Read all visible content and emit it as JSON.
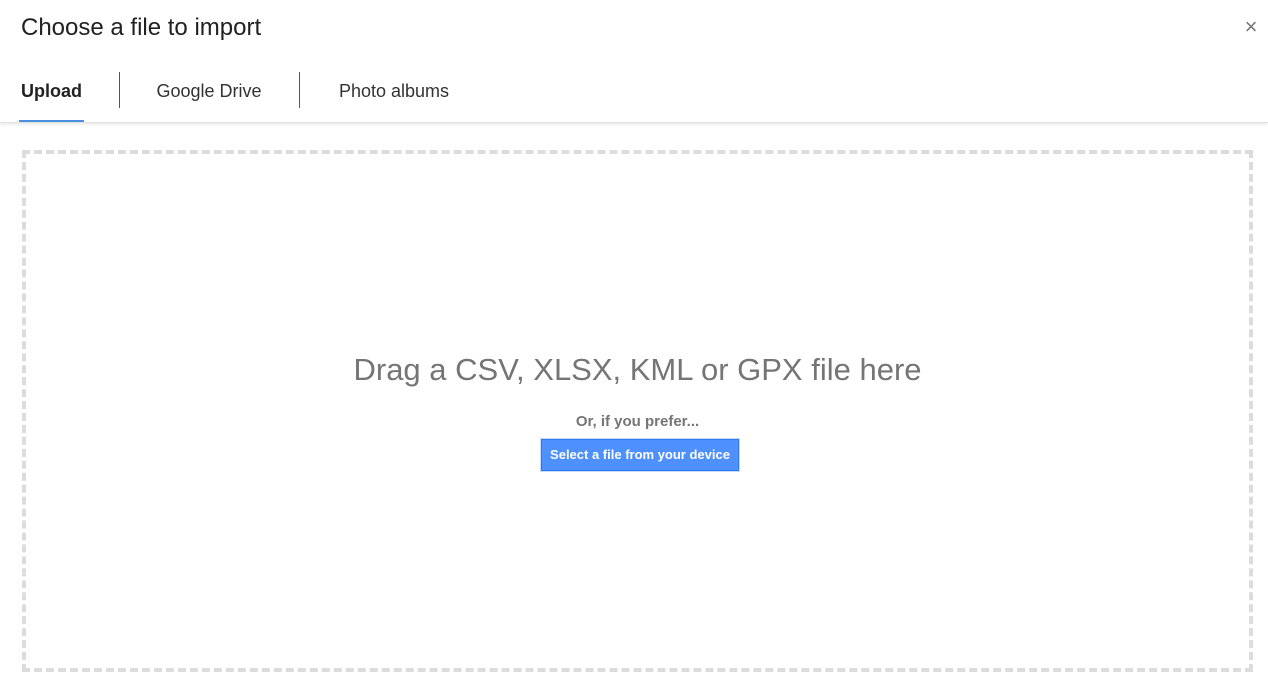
{
  "dialog": {
    "title": "Choose a file to import",
    "close_label": "×"
  },
  "tabs": [
    {
      "label": "Upload",
      "active": true
    },
    {
      "label": "Google Drive",
      "active": false
    },
    {
      "label": "Photo albums",
      "active": false
    }
  ],
  "dropzone": {
    "heading": "Drag a CSV, XLSX, KML or GPX file here",
    "subtext": "Or, if you prefer...",
    "button_label": "Select a file from your device"
  },
  "colors": {
    "accent": "#4a90e2",
    "button": "#4d90fe"
  }
}
